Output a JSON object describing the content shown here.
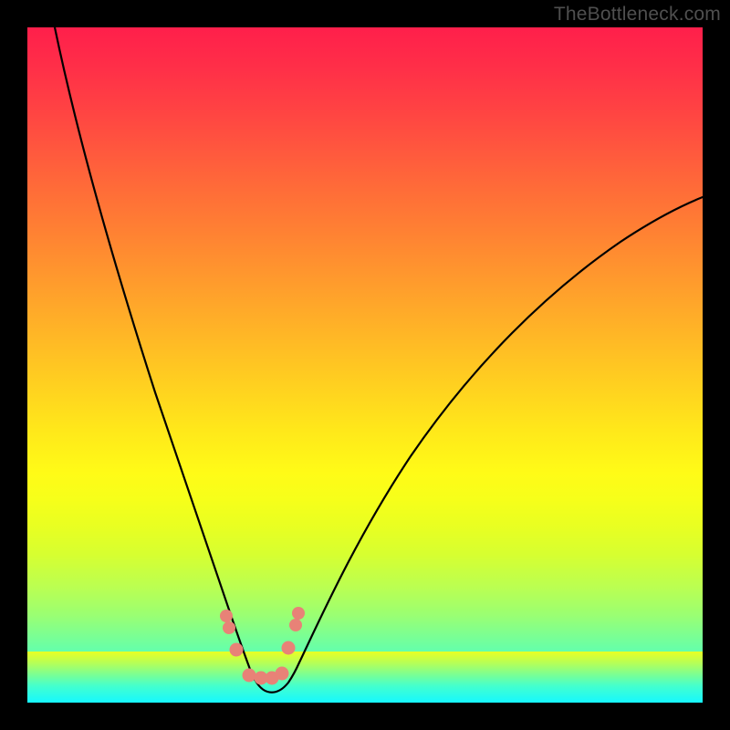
{
  "watermark": "TheBottleneck.com",
  "colors": {
    "frame": "#000000",
    "watermark_text": "#4f4f4f",
    "curve_stroke": "#000000",
    "marker_fill": "#e88277",
    "gradient_top": "#ff1f4b",
    "gradient_mid_yellow": "#fffb17",
    "gradient_bottom": "#15f8ff"
  },
  "chart_data": {
    "type": "line",
    "title": "",
    "xlabel": "",
    "ylabel": "",
    "xlim": [
      0,
      100
    ],
    "ylim": [
      0,
      100
    ],
    "note": "Axes, ticks, and numeric labels are not rendered in the image; values are fractional positions (0–100) inferred from pixel geometry of a bottleneck V-curve.",
    "series": [
      {
        "name": "left-branch",
        "x": [
          4,
          7,
          10,
          13,
          16,
          19,
          22,
          25,
          27,
          29,
          30.5,
          32
        ],
        "y": [
          100,
          87,
          74,
          62,
          50,
          39,
          29,
          19,
          12,
          6,
          3,
          1
        ]
      },
      {
        "name": "valley",
        "x": [
          32,
          33.5,
          35,
          36.5,
          38
        ],
        "y": [
          1,
          0.3,
          0.1,
          0.3,
          1
        ]
      },
      {
        "name": "right-branch",
        "x": [
          38,
          40,
          44,
          50,
          58,
          66,
          75,
          84,
          92,
          100
        ],
        "y": [
          1,
          3,
          8,
          16,
          27,
          38,
          49,
          59,
          67,
          74
        ]
      }
    ],
    "markers": [
      {
        "name": "left-upper-double",
        "x_frac": 0.295,
        "y_frac_from_top": 0.88,
        "shape": "double-bead"
      },
      {
        "name": "left-lower",
        "x_frac": 0.31,
        "y_frac_from_top": 0.92,
        "shape": "bead"
      },
      {
        "name": "right-upper-double",
        "x_frac": 0.4,
        "y_frac_from_top": 0.875,
        "shape": "double-bead"
      },
      {
        "name": "right-lower",
        "x_frac": 0.385,
        "y_frac_from_top": 0.92,
        "shape": "bead"
      },
      {
        "name": "valley-left",
        "x_frac": 0.33,
        "y_frac_from_top": 0.96,
        "shape": "bead"
      },
      {
        "name": "valley-mid-left",
        "x_frac": 0.345,
        "y_frac_from_top": 0.962,
        "shape": "bead"
      },
      {
        "name": "valley-mid-right",
        "x_frac": 0.355,
        "y_frac_from_top": 0.962,
        "shape": "bead"
      },
      {
        "name": "valley-right",
        "x_frac": 0.37,
        "y_frac_from_top": 0.96,
        "shape": "bead"
      }
    ]
  }
}
